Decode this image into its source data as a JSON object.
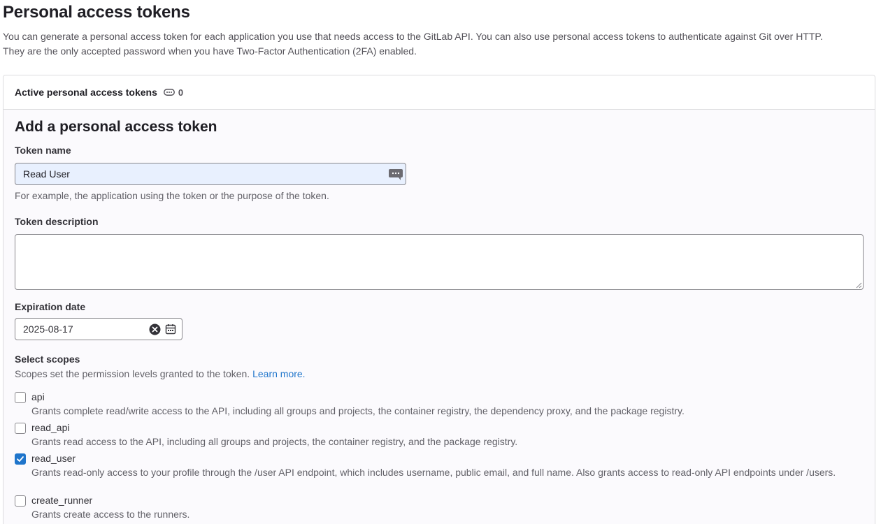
{
  "page": {
    "title": "Personal access tokens",
    "description_line1": "You can generate a personal access token for each application you use that needs access to the GitLab API. You can also use personal access tokens to authenticate against Git over HTTP.",
    "description_line2": "They are the only accepted password when you have Two-Factor Authentication (2FA) enabled."
  },
  "active_tokens": {
    "label": "Active personal access tokens",
    "count": "0"
  },
  "form": {
    "title": "Add a personal access token",
    "token_name": {
      "label": "Token name",
      "value": "Read User",
      "helper": "For example, the application using the token or the purpose of the token."
    },
    "token_description": {
      "label": "Token description",
      "value": ""
    },
    "expiration": {
      "label": "Expiration date",
      "value": "2025-08-17"
    },
    "scopes": {
      "label": "Select scopes",
      "helper": "Scopes set the permission levels granted to the token.",
      "learn_more": "Learn more.",
      "items": [
        {
          "name": "api",
          "checked": false,
          "description": "Grants complete read/write access to the API, including all groups and projects, the container registry, the dependency proxy, and the package registry."
        },
        {
          "name": "read_api",
          "checked": false,
          "description": "Grants read access to the API, including all groups and projects, the container registry, and the package registry."
        },
        {
          "name": "read_user",
          "checked": true,
          "description": "Grants read-only access to your profile through the /user API endpoint, which includes username, public email, and full name. Also grants access to read-only API endpoints under /users."
        },
        {
          "name": "create_runner",
          "checked": false,
          "description": "Grants create access to the runners."
        }
      ]
    }
  },
  "colors": {
    "link": "#1f75cb",
    "checkbox_checked": "#1f75cb",
    "autofill_bg": "#e8f0fe"
  }
}
